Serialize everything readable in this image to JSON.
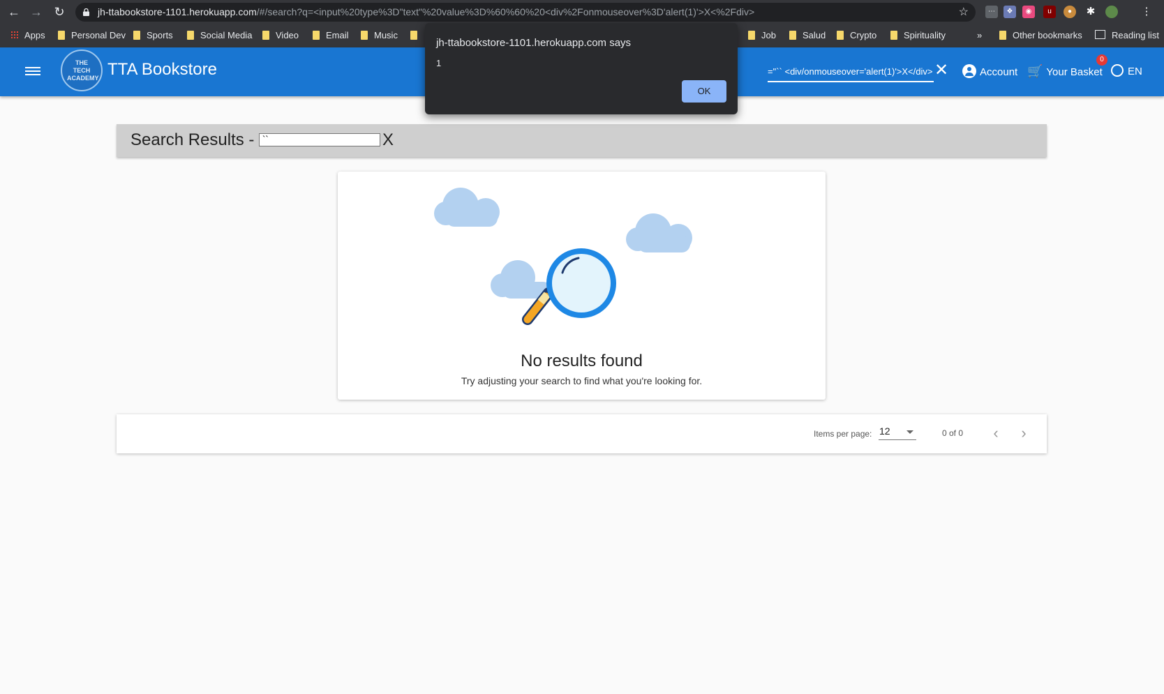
{
  "browser": {
    "url_host": "jh-ttabookstore-1101.herokuapp.com",
    "url_path": "/#/search?q=<input%20type%3D\"text\"%20value%3D%60%60%20<div%2Fonmouseover%3D'alert(1)'>X<%2Fdiv>",
    "bookmarks": [
      "Apps",
      "Personal Dev",
      "Sports",
      "Social Media",
      "Video",
      "Email",
      "Music",
      "Job",
      "Salud",
      "Crypto",
      "Spirituality",
      "»",
      "Other bookmarks",
      "Reading list"
    ]
  },
  "alert": {
    "title": "jh-ttabookstore-1101.herokuapp.com says",
    "message": "1",
    "ok_label": "OK"
  },
  "header": {
    "logo_text": "THE TECH ACADEMY",
    "title": "TTA Bookstore",
    "search_value": "=\"`` <div/onmouseover='alert(1)'>X</div>",
    "account_label": "Account",
    "basket_label": "Your Basket",
    "basket_count": "0",
    "language_label": "EN"
  },
  "results": {
    "heading": "Search Results -",
    "injected_input_value": "``",
    "injected_text": "X"
  },
  "empty_state": {
    "title": "No results found",
    "subtitle": "Try adjusting your search to find what you're looking for."
  },
  "paginator": {
    "items_per_page_label": "Items per page:",
    "items_per_page_value": "12",
    "range_label": "0 of 0"
  },
  "colors": {
    "toolbar": "#1976d2",
    "alert_button": "#8ab4f8",
    "badge": "#e53935"
  }
}
